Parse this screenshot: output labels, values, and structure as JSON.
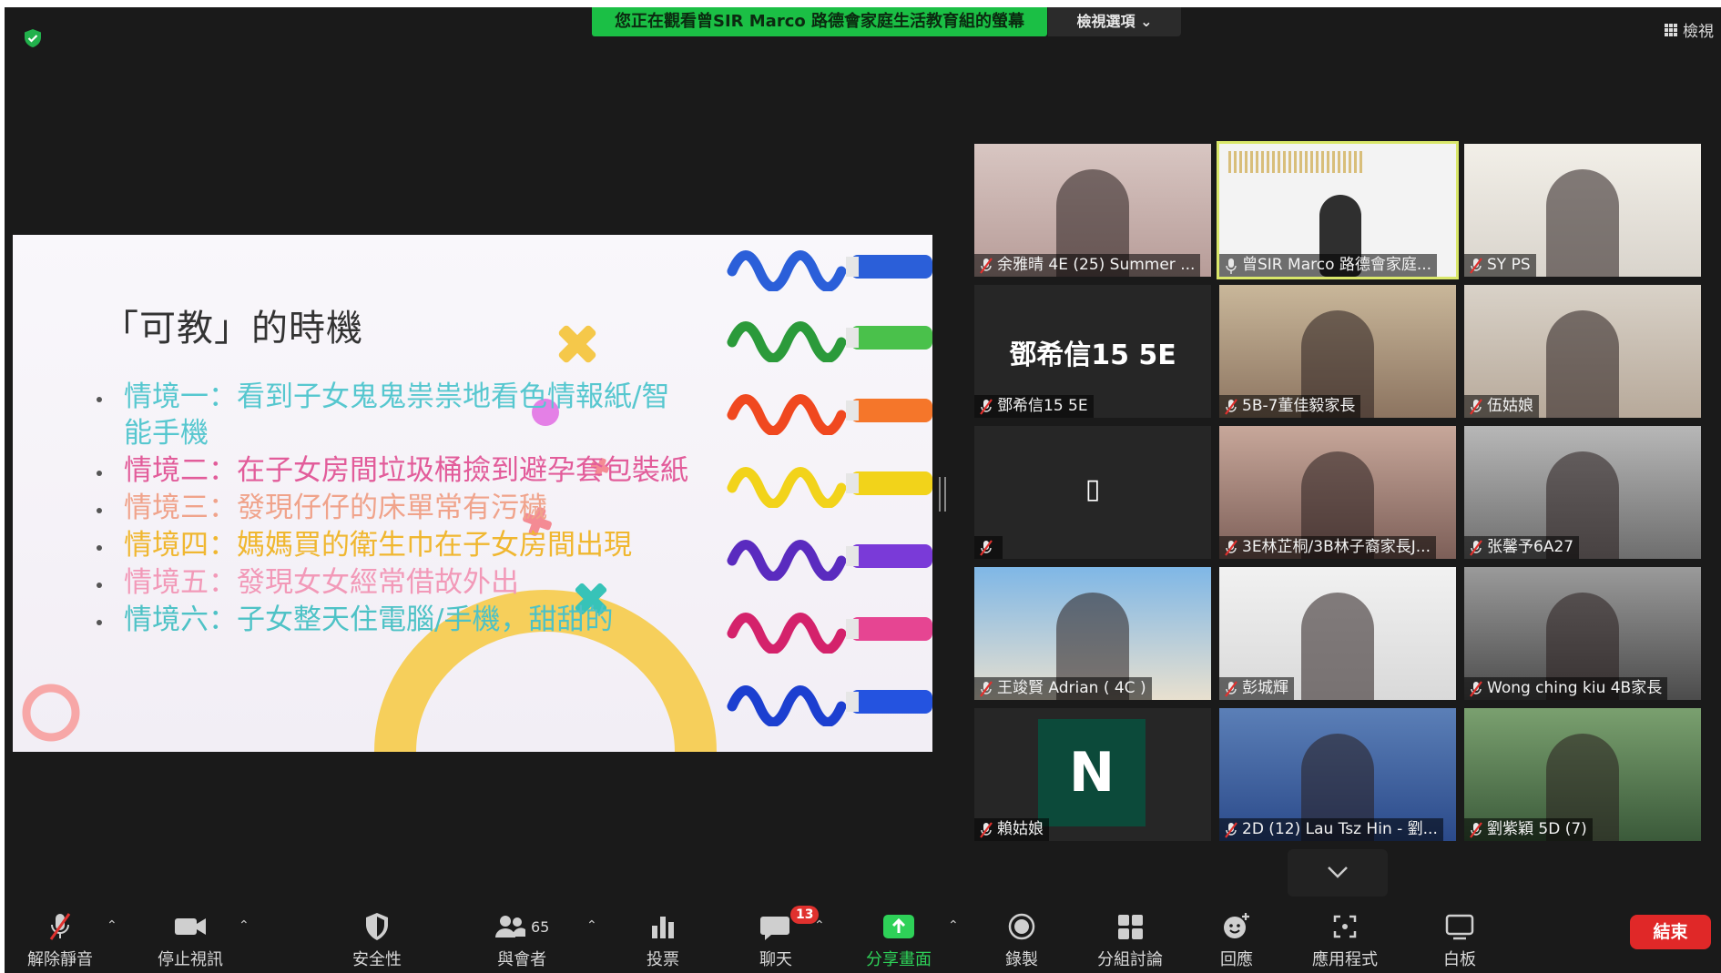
{
  "top": {
    "viewing_banner": "您正在觀看曾SIR Marco 路德會家庭生活教育組的螢幕",
    "view_options": "檢視選項 ⌄",
    "view_button": "檢視"
  },
  "slide": {
    "title": "「可教」的時機",
    "bullets": [
      "情境一：看到子女鬼鬼祟祟地看色情報紙/智能手機",
      "情境二：在子女房間垃圾桶撿到避孕套包裝紙",
      "情境三：發現仔仔的床單常有污穢",
      "情境四：媽媽買的衛生巾在子女房間出現",
      "情境五：發現女女經常借故外出",
      "情境六：子女整天住電腦/手機，甜甜的"
    ]
  },
  "participants": [
    {
      "name": "余雅晴 4E (25) Summer ...",
      "muted": true
    },
    {
      "name": "曾SIR Marco 路德會家庭...",
      "muted": false,
      "active": true
    },
    {
      "name": "SY PS",
      "muted": true
    },
    {
      "name": "鄧希信15 5E",
      "muted": true,
      "avatar_text": "鄧希信15 5E"
    },
    {
      "name": "5B-7董佳毅家長",
      "muted": true
    },
    {
      "name": "伍姑娘",
      "muted": true
    },
    {
      "name": "",
      "muted": true,
      "avatar_text": "▯"
    },
    {
      "name": "3E林芷桐/3B林子裔家長J...",
      "muted": true
    },
    {
      "name": "张馨予6A27",
      "muted": true
    },
    {
      "name": "王竣賢 Adrian ( 4C )",
      "muted": true
    },
    {
      "name": "彭城輝",
      "muted": true
    },
    {
      "name": "Wong ching kiu 4B家長",
      "muted": true
    },
    {
      "name": "賴姑娘",
      "muted": true,
      "avatar_text": "N"
    },
    {
      "name": "2D (12) Lau Tsz Hin - 劉...",
      "muted": true
    },
    {
      "name": "劉紫穎 5D (7)",
      "muted": true
    }
  ],
  "toolbar": {
    "unmute": "解除靜音",
    "stop_video": "停止視訊",
    "security": "安全性",
    "participants": "與會者",
    "participant_count": "65",
    "polls": "投票",
    "chat": "聊天",
    "chat_badge": "13",
    "share_screen": "分享畫面",
    "record": "錄製",
    "breakout": "分組討論",
    "reactions": "回應",
    "apps": "應用程式",
    "whiteboard": "白板",
    "end": "結束"
  },
  "colors": {
    "banner_green": "#1bbf45",
    "active_border": "#d9e76a",
    "end_red": "#e02828",
    "share_green": "#2ed158"
  }
}
